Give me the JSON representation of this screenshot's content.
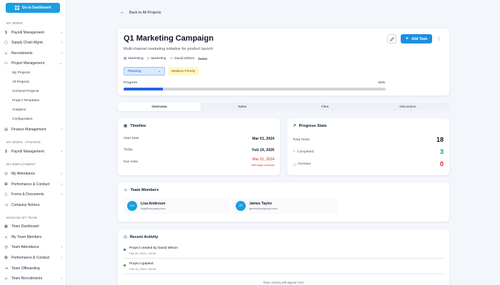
{
  "sidebar": {
    "dashboard_button": "Go to Dashboard",
    "sections": {
      "my_work": "MY WORK",
      "my_work_finance": "MY WORK - FINANCE",
      "my_employment": "MY EMPLOYMENT",
      "manage_my_team": "MANAGE MY TEAM"
    },
    "items": {
      "payroll": "Payroll Management",
      "supply_chain": "Supply Chain Mgmt.",
      "recruitments": "Recruitments",
      "project_management": "Project Management",
      "finance_management": "Finance Management",
      "payroll_finance": "Payroll Management",
      "my_attendance": "My Attendance",
      "performance": "Performance & Conduct",
      "forms": "Forms & Documents",
      "notices": "Company Notices",
      "team_dashboard": "Team Dashboard",
      "my_team_members": "My Team Members",
      "team_attendance": "Team Attendance",
      "team_performance": "Performance & Conduct",
      "team_offboarding": "Team Offboarding",
      "team_recruitments": "Team Recruitments"
    },
    "subitems": [
      "My Projects",
      "All Projects",
      "Archived Projects",
      "Project Templates",
      "Analytics",
      "Configuration"
    ]
  },
  "header": {
    "back_label": "Back to All Projects"
  },
  "project": {
    "title": "Q1 Marketing Campaign",
    "subtitle": "Multi-channel marketing initiative for product launch",
    "meta": {
      "category": "Marketing",
      "tag": "Marketing",
      "owner_name": "David Wilson",
      "owner_role": "Owner"
    },
    "status": "Planning",
    "priority": "Medium Priority",
    "progress_label": "Progress",
    "progress_value": "15%",
    "progress_fraction": 0.15,
    "add_task_label": "Add Task"
  },
  "tabs": [
    "Overview",
    "Tasks",
    "Files",
    "Discussion"
  ],
  "timeline": {
    "title": "Timeline",
    "start_label": "Start Date",
    "start_value": "Mar 01, 2024",
    "today_label": "Today",
    "today_value": "Feb 19, 2026",
    "due_label": "Due Date",
    "due_value": "Mar 31, 2024",
    "overdue_text": "689 days overdue"
  },
  "stats": {
    "title": "Progress Stats",
    "total_label": "Total Tasks",
    "total_value": "18",
    "completed_label": "Completed",
    "completed_value": "3",
    "overdue_label": "Overdue",
    "overdue_value": "0"
  },
  "team": {
    "title": "Team Members",
    "members": [
      {
        "initials": "LA",
        "name": "Lisa Anderson",
        "email": "lisa@company.com"
      },
      {
        "initials": "JT",
        "name": "James Taylor",
        "email": "james@company.com"
      }
    ]
  },
  "activity": {
    "title": "Recent Activity",
    "items": [
      {
        "text": "Project created by David Wilson",
        "date": "Feb 05, 2024 • 09:00"
      },
      {
        "text": "Project updated",
        "date": "Feb 10, 2024 • 09:00"
      }
    ],
    "footer": "Team activity will appear here"
  },
  "colors": {
    "accent": "#1a9fe0",
    "primary": "#2563eb",
    "danger": "#dc2626",
    "success": "#16a34a"
  }
}
